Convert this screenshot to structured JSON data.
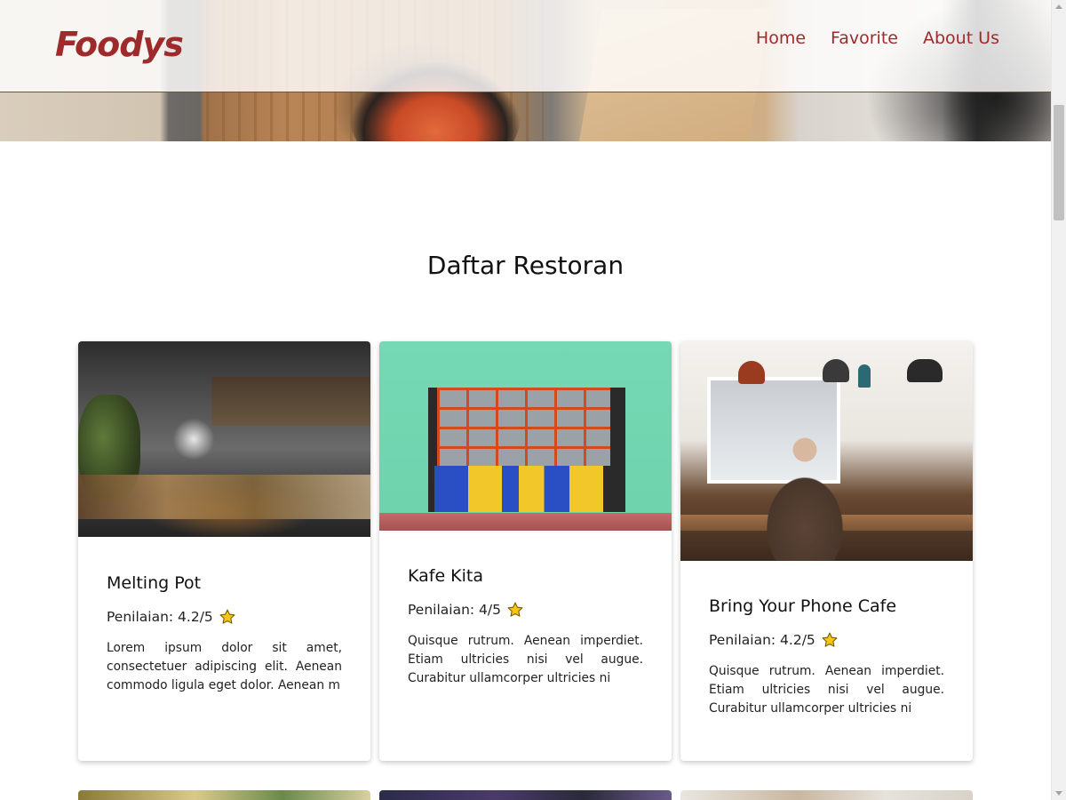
{
  "navbar": {
    "brand": "Foodys",
    "links": [
      {
        "label": "Home"
      },
      {
        "label": "Favorite"
      },
      {
        "label": "About Us"
      }
    ]
  },
  "section": {
    "title": "Daftar Restoran"
  },
  "restaurants": [
    {
      "name": "Melting Pot",
      "rating": "Penilaian: 4.2/5",
      "description": "Lorem ipsum dolor sit amet, consectetuer adipiscing elit. Aenean commodo ligula eget dolor. Aenean m"
    },
    {
      "name": "Kafe Kita",
      "rating": "Penilaian: 4/5",
      "description": "Quisque rutrum. Aenean imperdiet. Etiam ultricies nisi vel augue. Curabitur ullamcorper ultricies ni"
    },
    {
      "name": "Bring Your Phone Cafe",
      "rating": "Penilaian: 4.2/5",
      "description": "Quisque rutrum. Aenean imperdiet. Etiam ultricies nisi vel augue. Curabitur ullamcorper ultricies ni"
    }
  ],
  "colors": {
    "brand": "#9e2b2b",
    "star": "#f5c518"
  },
  "icons": {
    "rating": "star-icon"
  }
}
